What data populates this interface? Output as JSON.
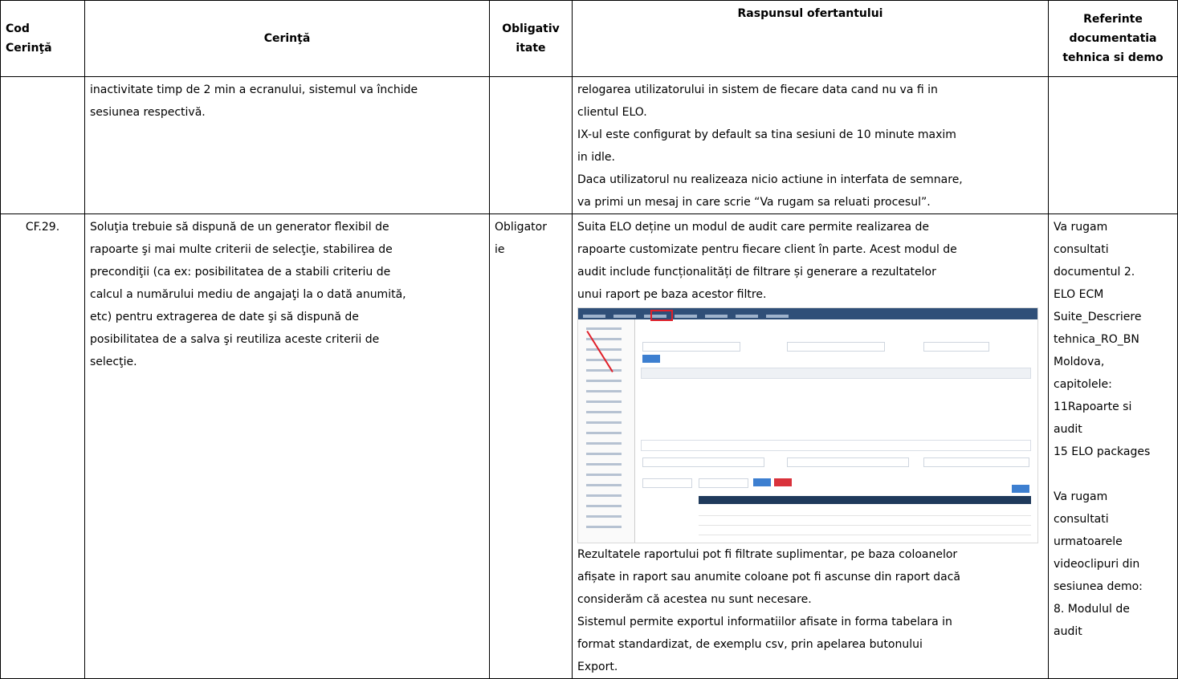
{
  "headers": {
    "cod": "Cod Cerinţă",
    "cerinta": "Cerinţă",
    "obligativ": "Obligativ itate",
    "raspuns": "Raspunsul ofertantului",
    "referinte": "Referinte documentatia tehnica si demo"
  },
  "row1": {
    "cerinta_lines": [
      "inactivitate timp de 2 min a ecranului, sistemul va închide",
      "sesiunea respectivă."
    ],
    "raspuns_lines": [
      "relogarea utilizatorului in sistem de fiecare data cand nu va fi in",
      "clientul ELO.",
      "IX-ul este configurat by default sa tina sesiuni de 10 minute maxim",
      "in idle.",
      "Daca utilizatorul nu realizeaza nicio actiune in interfata de semnare,",
      "va primi un mesaj in care scrie “Va rugam sa reluati procesul”."
    ]
  },
  "row2": {
    "cod": "CF.29.",
    "cerinta_lines": [
      "Soluţia trebuie să dispună de un generator flexibil de",
      "rapoarte şi mai multe criterii de selecţie, stabilirea de",
      "precondiţii (ca ex: posibilitatea de a stabili criteriu de",
      "calcul a numărului mediu de angajaţi la o dată anumită,",
      "etc) pentru extragerea de date şi să dispună de",
      "posibilitatea de a salva şi reutiliza aceste criterii de",
      "selecţie."
    ],
    "obligativ_lines": [
      "Obligator",
      "ie"
    ],
    "raspuns_lines_top": [
      "Suita ELO deține un modul de audit care permite realizarea de",
      "rapoarte customizate pentru fiecare client în parte. Acest modul de",
      "audit include funcționalități de filtrare și generare a rezultatelor",
      "unui raport pe baza acestor filtre."
    ],
    "raspuns_lines_bottom": [
      "Rezultatele raportului pot fi filtrate suplimentar, pe baza coloanelor",
      "afișate in raport sau anumite coloane pot fi ascunse din raport dacă",
      "considerăm că acestea nu sunt necesare.",
      "Sistemul permite exportul informatiilor afisate in forma tabelara in",
      "format standardizat, de exemplu csv, prin apelarea butonului",
      "Export."
    ],
    "referinte_lines": [
      "Va rugam",
      "consultati",
      "documentul 2.",
      "ELO ECM",
      "Suite_Descriere",
      "tehnica_RO_BN",
      "Moldova,",
      "capitolele:",
      "11Rapoarte si",
      "audit",
      "15 ELO packages",
      "",
      "Va rugam",
      "consultati",
      "urmatoarele",
      "videoclipuri din",
      "sesiunea demo:",
      "8. Modulul de",
      "audit"
    ]
  }
}
